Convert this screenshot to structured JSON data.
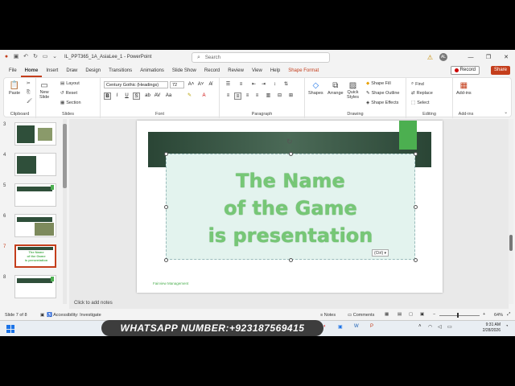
{
  "titlebar": {
    "filename": "IL_PPT365_1A_AsiaLee_1",
    "sep": "-",
    "app": "PowerPoint",
    "search_placeholder": "Search",
    "avatar": "AL"
  },
  "menu": [
    "File",
    "Home",
    "Insert",
    "Draw",
    "Design",
    "Transitions",
    "Animations",
    "Slide Show",
    "Record",
    "Review",
    "View",
    "Help",
    "Shape Format"
  ],
  "buttons": {
    "record": "Record",
    "share": "Share"
  },
  "ribbon": {
    "clipboard": {
      "paste": "Paste",
      "label": "Clipboard"
    },
    "slides": {
      "new_slide_line1": "New",
      "new_slide_line2": "Slide",
      "layout": "Layout",
      "reset": "Reset",
      "section": "Section",
      "label": "Slides"
    },
    "font": {
      "name": "Century Gothic (Headings)",
      "size": "72",
      "label": "Font"
    },
    "paragraph": {
      "label": "Paragraph"
    },
    "drawing": {
      "shapes": "Shapes",
      "arrange": "Arrange",
      "quick_styles_line1": "Quick",
      "quick_styles_line2": "Styles",
      "fill": "Shape Fill",
      "outline": "Shape Outline",
      "effects": "Shape Effects",
      "label": "Drawing"
    },
    "editing": {
      "find": "Find",
      "replace": "Replace",
      "select": "Select",
      "label": "Editing"
    },
    "addins": {
      "button": "Add-ins",
      "label": "Add-ins"
    }
  },
  "thumbnails": [
    {
      "num": "3",
      "selected": false
    },
    {
      "num": "4",
      "selected": false
    },
    {
      "num": "5",
      "selected": false
    },
    {
      "num": "6",
      "selected": false
    },
    {
      "num": "7",
      "selected": true,
      "text_line1": "The Name",
      "text_line2": "of the Game",
      "text_line3": "is presentation"
    },
    {
      "num": "8",
      "selected": false
    }
  ],
  "slide": {
    "title_line1": "The Name",
    "title_line2": "of the Game",
    "title_line3": "is presentation",
    "ctrl_tag": "(Ctrl)",
    "footer": "Fairview Management"
  },
  "notes_placeholder": "Click to add notes",
  "status": {
    "slide_count": "Slide 7 of 8",
    "accessibility": "Accessibility: Investigate",
    "notes": "Notes",
    "comments": "Comments",
    "zoom": "64%"
  },
  "taskbar": {
    "whatsapp": "WHATSAPP NUMBER:+923187569415",
    "time": "9:31 AM",
    "date": "2/28/2026"
  },
  "colors": {
    "accent": "#c43e1c",
    "slide_green": "#4caf50",
    "banner": "#2e4c3a"
  }
}
